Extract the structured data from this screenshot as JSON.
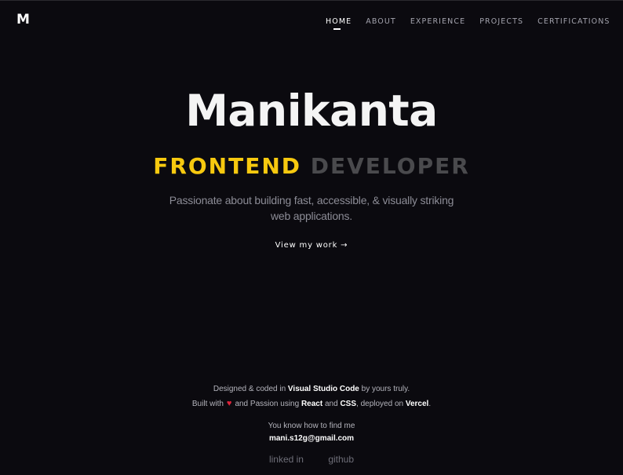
{
  "header": {
    "logo": "M",
    "nav": [
      "HOME",
      "ABOUT",
      "EXPERIENCE",
      "PROJECTS",
      "CERTIFICATIONS"
    ],
    "active": "HOME"
  },
  "hero": {
    "name": "Manikanta",
    "role_primary": "FRONTEND",
    "role_secondary": "DEVELOPER",
    "tagline": "Passionate about building fast, accessible, & visually striking web applications.",
    "cta": "View my work →"
  },
  "footer": {
    "line1_prefix": "Designed & coded in ",
    "line1_tool": "Visual Studio Code",
    "line1_suffix": " by yours truly.",
    "line2_prefix": "Built with",
    "line2_mid": "and Passion using ",
    "line2_react": "React",
    "line2_and": " and ",
    "line2_css": "CSS",
    "line2_deployed": ", deployed on ",
    "line2_vercel": "Vercel",
    "line2_end": ".",
    "find_label": "You know how to find me",
    "email": "mani.s12g@gmail.com",
    "link_linkedin": "linked in",
    "link_github": "github"
  },
  "colors": {
    "background": "#0b0a0f",
    "accent_yellow": "#f7c90f",
    "muted_gray": "#4a4a4d",
    "heart_red": "#e0243b"
  }
}
